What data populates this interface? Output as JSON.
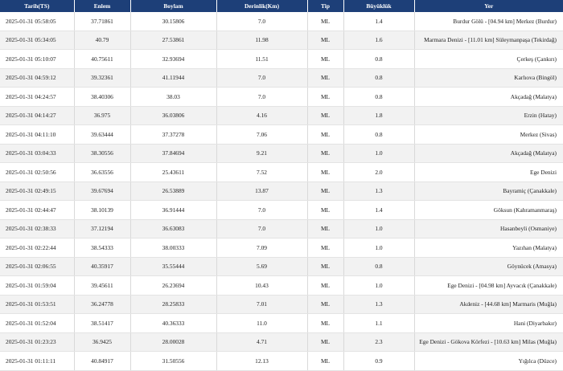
{
  "table": {
    "headers": [
      "Tarih(TS)",
      "Enlem",
      "Boylam",
      "Derinlik(Km)",
      "Tip",
      "Büyüklük",
      "Yer"
    ],
    "rows": [
      [
        "2025-01-31 05:58:05",
        "37.71861",
        "30.15806",
        "7.0",
        "ML",
        "1.4",
        "Burdur Gölü - [04.94 km] Merkez (Burdur)"
      ],
      [
        "2025-01-31 05:34:05",
        "40.79",
        "27.53861",
        "11.98",
        "ML",
        "1.6",
        "Marmara Denizi - [11.01 km] Süleymanpaşa (Tekirdağ)"
      ],
      [
        "2025-01-31 05:10:07",
        "40.75611",
        "32.93694",
        "11.51",
        "ML",
        "0.8",
        "Çerkeş (Çankırı)"
      ],
      [
        "2025-01-31 04:59:12",
        "39.32361",
        "41.11944",
        "7.0",
        "ML",
        "0.8",
        "Karlıova (Bingöl)"
      ],
      [
        "2025-01-31 04:24:57",
        "38.40306",
        "38.03",
        "7.0",
        "ML",
        "0.8",
        "Akçadağ (Malatya)"
      ],
      [
        "2025-01-31 04:14:27",
        "36.975",
        "36.03806",
        "4.16",
        "ML",
        "1.8",
        "Erzin (Hatay)"
      ],
      [
        "2025-01-31 04:11:10",
        "39.63444",
        "37.37278",
        "7.06",
        "ML",
        "0.8",
        "Merkez (Sivas)"
      ],
      [
        "2025-01-31 03:04:33",
        "38.30556",
        "37.84694",
        "9.21",
        "ML",
        "1.0",
        "Akçadağ (Malatya)"
      ],
      [
        "2025-01-31 02:50:56",
        "36.63556",
        "25.43611",
        "7.52",
        "ML",
        "2.0",
        "Ege Denizi"
      ],
      [
        "2025-01-31 02:49:15",
        "39.67694",
        "26.53889",
        "13.87",
        "ML",
        "1.3",
        "Bayramiç (Çanakkale)"
      ],
      [
        "2025-01-31 02:44:47",
        "38.10139",
        "36.91444",
        "7.0",
        "ML",
        "1.4",
        "Göksun (Kahramanmaraş)"
      ],
      [
        "2025-01-31 02:38:33",
        "37.12194",
        "36.63083",
        "7.0",
        "ML",
        "1.0",
        "Hasanbeyli (Osmaniye)"
      ],
      [
        "2025-01-31 02:22:44",
        "38.54333",
        "38.00333",
        "7.09",
        "ML",
        "1.0",
        "Yazıhan (Malatya)"
      ],
      [
        "2025-01-31 02:06:55",
        "40.35917",
        "35.55444",
        "5.69",
        "ML",
        "0.8",
        "Göynücek (Amasya)"
      ],
      [
        "2025-01-31 01:59:04",
        "39.45611",
        "26.23694",
        "10.43",
        "ML",
        "1.0",
        "Ege Denizi - [04.98 km] Ayvacık (Çanakkale)"
      ],
      [
        "2025-01-31 01:53:51",
        "36.24778",
        "28.25833",
        "7.01",
        "ML",
        "1.3",
        "Akdeniz - [44.68 km] Marmaris (Muğla)"
      ],
      [
        "2025-01-31 01:52:04",
        "38.51417",
        "40.36333",
        "11.0",
        "ML",
        "1.1",
        "Hani (Diyarbakır)"
      ],
      [
        "2025-01-31 01:23:23",
        "36.9425",
        "28.00028",
        "4.71",
        "ML",
        "2.3",
        "Ege Denizi - Gökova Körfezi - [10.63 km] Milas (Muğla)"
      ],
      [
        "2025-01-31 01:11:11",
        "40.84917",
        "31.50556",
        "12.13",
        "ML",
        "0.9",
        "Yığılca (Düzce)"
      ]
    ]
  }
}
